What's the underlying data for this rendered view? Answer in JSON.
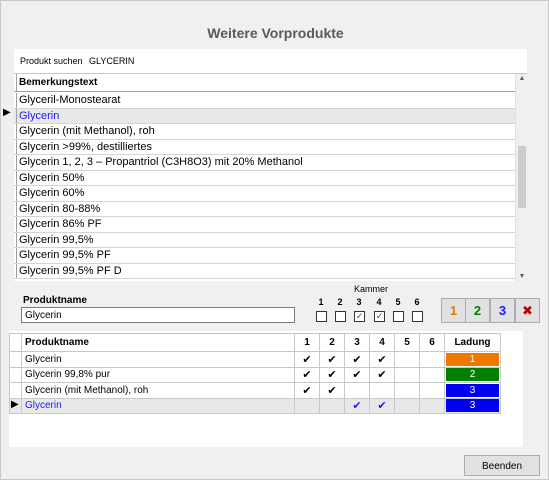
{
  "dialog": {
    "title": "Weitere Vorprodukte"
  },
  "search": {
    "label": "Produkt suchen",
    "value": "GLYCERIN"
  },
  "top_grid": {
    "header": "Bemerkungstext",
    "rows": [
      "Glyceril-Monostearat",
      "Glycerin",
      "Glycerin (mit Methanol), roh",
      "Glycerin >99%, destilliertes",
      "Glycerin 1, 2, 3 – Propantriol (C3H8O3) mit 20% Methanol",
      "Glycerin 50%",
      "Glycerin 60%",
      "Glycerin 80-88%",
      "Glycerin 86% PF",
      "Glycerin 99,5%",
      "Glycerin 99,5% PF",
      "Glycerin 99,5% PF D"
    ],
    "selected_index": 1
  },
  "produktname": {
    "label": "Produktname",
    "value": "Glycerin"
  },
  "kammer": {
    "label": "Kammer",
    "numbers": [
      "1",
      "2",
      "3",
      "4",
      "5",
      "6"
    ],
    "checked": [
      false,
      false,
      true,
      true,
      false,
      false
    ]
  },
  "ladung_buttons": [
    {
      "label": "1",
      "color": "#f07800"
    },
    {
      "label": "2",
      "color": "#008000"
    },
    {
      "label": "3",
      "color": "#1a1aff"
    },
    {
      "label": "✖",
      "color": "#c00000"
    }
  ],
  "bottom_grid": {
    "headers": [
      "Produktname",
      "1",
      "2",
      "3",
      "4",
      "5",
      "6",
      "Ladung"
    ],
    "rows": [
      {
        "name": "Glycerin",
        "checks": [
          "✔",
          "✔",
          "✔",
          "✔",
          "",
          ""
        ],
        "ladung": "1",
        "color": "#f07800"
      },
      {
        "name": "Glycerin 99,8% pur",
        "checks": [
          "✔",
          "✔",
          "✔",
          "✔",
          "",
          ""
        ],
        "ladung": "2",
        "color": "#008000"
      },
      {
        "name": "Glycerin (mit Methanol), roh",
        "checks": [
          "✔",
          "✔",
          "",
          "",
          "",
          ""
        ],
        "ladung": "3",
        "color": "#0000f0"
      },
      {
        "name": "Glycerin",
        "checks": [
          "",
          "",
          "✔",
          "✔",
          "",
          ""
        ],
        "ladung": "3",
        "color": "#0000f0"
      }
    ],
    "selected_index": 3
  },
  "footer": {
    "beenden_label": "Beenden"
  }
}
